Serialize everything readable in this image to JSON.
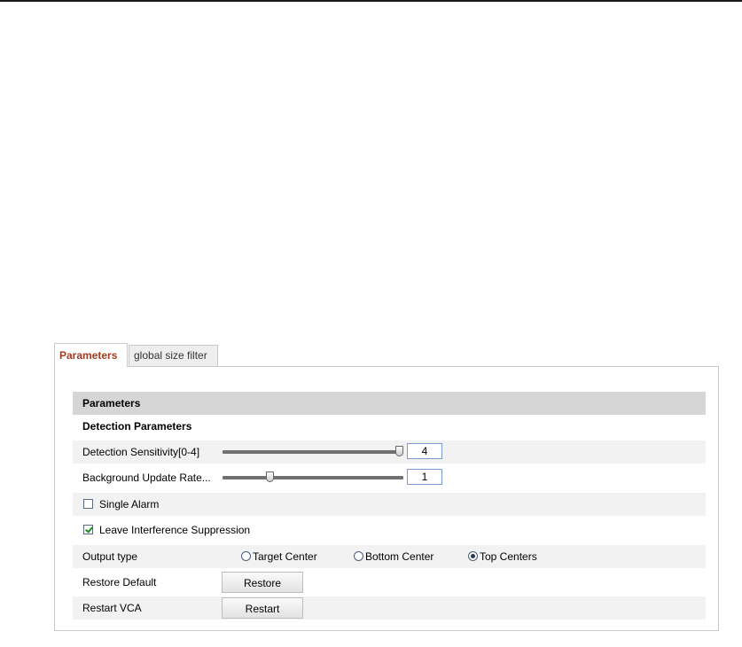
{
  "tabs": [
    {
      "label": "Parameters",
      "active": true
    },
    {
      "label": "global size filter",
      "active": false
    }
  ],
  "panel": {
    "header": "Parameters",
    "subheader": "Detection Parameters",
    "sensitivity": {
      "label": "Detection Sensitivity[0-4]",
      "value": "4",
      "level": 1.0
    },
    "background_rate": {
      "label": "Background Update Rate...",
      "value": "1",
      "level": 0.25
    },
    "single_alarm": {
      "label": "Single Alarm",
      "checked": false
    },
    "leave_interference": {
      "label": "Leave Interference Suppression",
      "checked": true
    },
    "output_type": {
      "label": "Output type",
      "options": [
        "Target Center",
        "Bottom Center",
        "Top Centers"
      ],
      "selected": "Top Centers"
    },
    "restore": {
      "label": "Restore Default",
      "button": "Restore"
    },
    "restart": {
      "label": "Restart VCA",
      "button": "Restart"
    }
  },
  "colors": {
    "active_tab_text": "#a23a1f",
    "header_bg": "#d6d6d6",
    "row_shade": "#f2f2f2",
    "check_green": "#1c8f1c"
  }
}
